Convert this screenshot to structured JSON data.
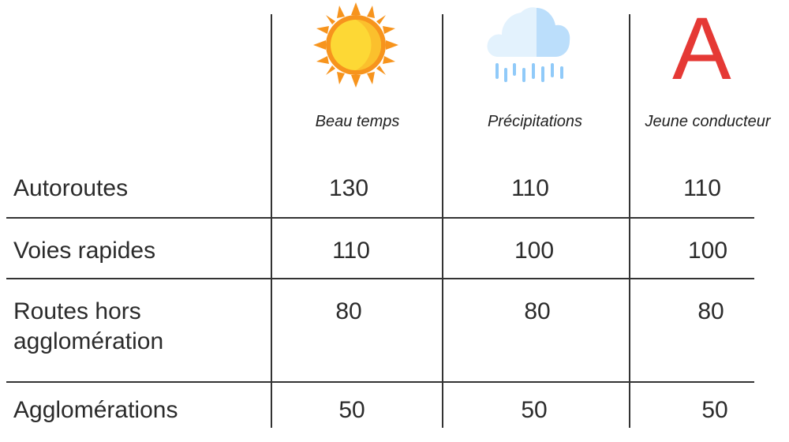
{
  "columns": [
    {
      "label": "Beau temps",
      "icon": "sun-icon"
    },
    {
      "label": "Précipitations",
      "icon": "rain-cloud-icon"
    },
    {
      "label": "Jeune conducteur",
      "icon": "young-driver-a-icon",
      "icon_text": "A"
    }
  ],
  "rows": [
    {
      "label": "Autoroutes",
      "values": [
        "130",
        "110",
        "110"
      ]
    },
    {
      "label": "Voies rapides",
      "values": [
        "110",
        "100",
        "100"
      ]
    },
    {
      "label": "Routes hors agglomération",
      "values": [
        "80",
        "80",
        "80"
      ]
    },
    {
      "label": "Agglomérations",
      "values": [
        "50",
        "50",
        "50"
      ]
    }
  ],
  "colors": {
    "sun_outer": "#F7941D",
    "sun_inner": "#FDD835",
    "cloud_light": "#E3F2FD",
    "cloud_dark": "#BBDEFB",
    "rain": "#90CAF9",
    "a_red": "#E53935"
  }
}
